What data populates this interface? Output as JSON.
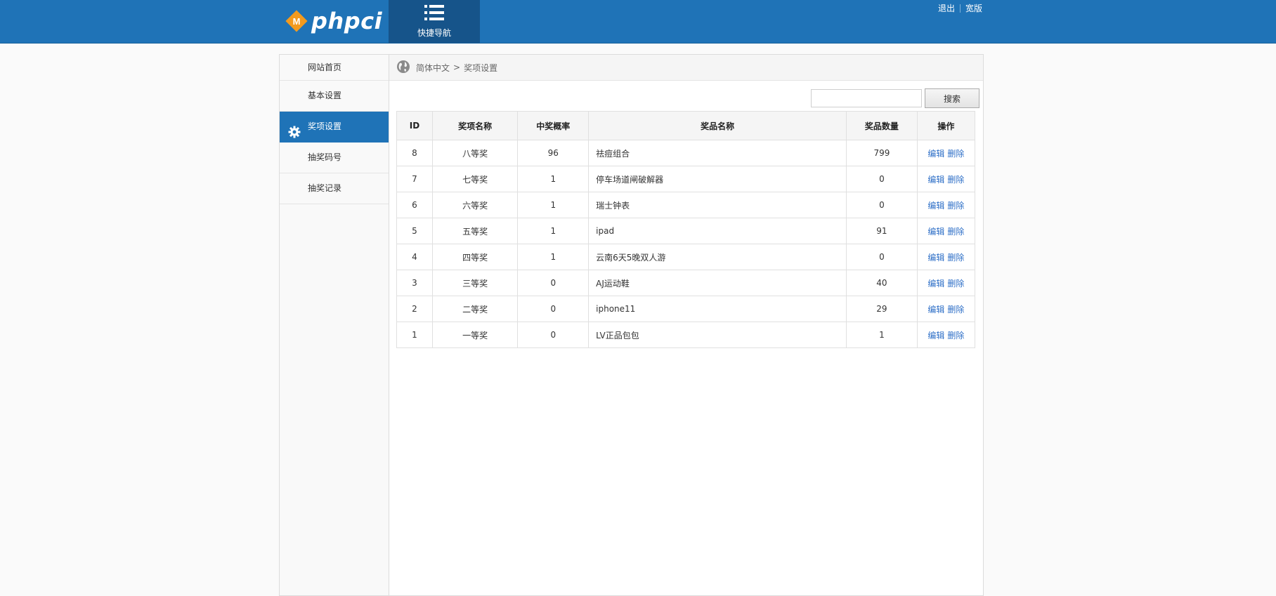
{
  "header": {
    "logo_text": "phpci",
    "logo_badge": "M",
    "quicknav_label": "快捷导航",
    "quicknav_icon": "list-icon",
    "links": {
      "logout": "退出",
      "wide": "宽版"
    },
    "colors": {
      "bar": "#1f73b7",
      "quicknav": "#16548a",
      "logo_badge": "#f39a1e"
    }
  },
  "sidebar": {
    "items": [
      {
        "label": "网站首页"
      },
      {
        "label": "基本设置"
      },
      {
        "label": "奖项设置",
        "active": true,
        "icon": "gear-icon"
      },
      {
        "label": "抽奖码号"
      },
      {
        "label": "抽奖记录"
      }
    ]
  },
  "breadcrumb": {
    "lang": "简体中文",
    "separator": ">",
    "current": "奖项设置",
    "icon": "globe-icon"
  },
  "search": {
    "placeholder": "",
    "value": "",
    "button_label": "搜索"
  },
  "table": {
    "headers": [
      "ID",
      "奖项名称",
      "中奖概率",
      "奖品名称",
      "奖品数量",
      "操作"
    ],
    "rows": [
      {
        "id": "8",
        "name": "八等奖",
        "rate": "96",
        "prize": "祛痘组合",
        "qty": "799"
      },
      {
        "id": "7",
        "name": "七等奖",
        "rate": "1",
        "prize": "停车场道闸破解器",
        "qty": "0"
      },
      {
        "id": "6",
        "name": "六等奖",
        "rate": "1",
        "prize": "瑞士钟表",
        "qty": "0"
      },
      {
        "id": "5",
        "name": "五等奖",
        "rate": "1",
        "prize": "ipad",
        "qty": "91"
      },
      {
        "id": "4",
        "name": "四等奖",
        "rate": "1",
        "prize": "云南6天5晚双人游",
        "qty": "0"
      },
      {
        "id": "3",
        "name": "三等奖",
        "rate": "0",
        "prize": "AJ运动鞋",
        "qty": "40"
      },
      {
        "id": "2",
        "name": "二等奖",
        "rate": "0",
        "prize": "iphone11",
        "qty": "29"
      },
      {
        "id": "1",
        "name": "一等奖",
        "rate": "0",
        "prize": "LV正品包包",
        "qty": "1"
      }
    ],
    "actions": {
      "edit": "编辑",
      "delete": "删除"
    },
    "link_color": "#2e6fc7"
  }
}
